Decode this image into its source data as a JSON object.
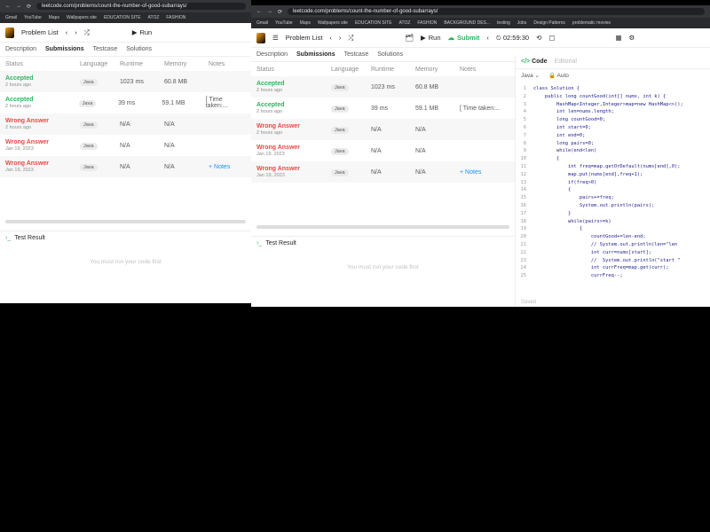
{
  "browser": {
    "url_back": "leetcode.com/problems/count-the-number-of-good-subarrays/",
    "url_front": "leetcode.com/problems/count-the-number-of-good-subarrays/",
    "bookmarks_back": [
      "Gmail",
      "YouTube",
      "Maps",
      "Wallpapers site",
      "EDUCATION SITE",
      "ATOZ",
      "FASHION"
    ],
    "bookmarks_front": [
      "Gmail",
      "YouTube",
      "Maps",
      "Wallpapers site",
      "EDUCATION SITE",
      "ATOZ",
      "FASHION",
      "BACKGROUND DES...",
      "testing",
      "Jobs",
      "Design Patterns",
      "problematic movies"
    ]
  },
  "topbar": {
    "problem_list": "Problem List",
    "run": "Run",
    "submit": "Submit",
    "timer": "02:59:30"
  },
  "tabs": {
    "description": "Description",
    "submissions": "Submissions",
    "testcase": "Testcase",
    "solutions": "Solutions"
  },
  "headers": {
    "status": "Status",
    "language": "Language",
    "runtime": "Runtime",
    "memory": "Memory",
    "notes": "Notes"
  },
  "submissions": [
    {
      "status": "Accepted",
      "date": "2 hours ago",
      "lang": "Java",
      "runtime": "1023 ms",
      "memory": "60.8 MB",
      "notes": ""
    },
    {
      "status": "Accepted",
      "date": "2 hours ago",
      "lang": "Java",
      "runtime": "39 ms",
      "memory": "59.1 MB",
      "notes": "[ Time taken:..."
    },
    {
      "status": "Wrong Answer",
      "date": "2 hours ago",
      "lang": "Java",
      "runtime": "N/A",
      "memory": "N/A",
      "notes": ""
    },
    {
      "status": "Wrong Answer",
      "date": "Jan 19, 2023",
      "lang": "Java",
      "runtime": "N/A",
      "memory": "N/A",
      "notes": ""
    },
    {
      "status": "Wrong Answer",
      "date": "Jan 19, 2023",
      "lang": "Java",
      "runtime": "N/A",
      "memory": "N/A",
      "notes": "+ Notes"
    }
  ],
  "test_result": {
    "title": "Test Result",
    "message": "You must run your code first"
  },
  "editor": {
    "tab_code": "Code",
    "tab_editorial": "Editorial",
    "language": "Java",
    "auto": "Auto",
    "saved": "Saved",
    "lines": [
      "class Solution {",
      "    public long countGood(int[] nums, int k) {",
      "        HashMap<Integer,Integer>map=new HashMap<>();",
      "        int len=nums.length;",
      "        long countGood=0;",
      "        int start=0;",
      "        int end=0;",
      "        long pairs=0;",
      "        while(end<len)",
      "        {",
      "            int freq=map.getOrDefault(nums[end],0);",
      "            map.put(nums[end],freq+1);",
      "            if(freq>0)",
      "            {",
      "                pairs+=freq;",
      "                System.out.println(pairs);",
      "            }",
      "            while(pairs>=k)",
      "                {",
      "                    countGood+=len-end;",
      "                    // System.out.println(len=\"len",
      "                    int curr=nums[start];",
      "                    //  System.out.println(\"start \"",
      "                    int currFreq=map.get(curr);",
      "                    currFreq--;"
    ]
  }
}
